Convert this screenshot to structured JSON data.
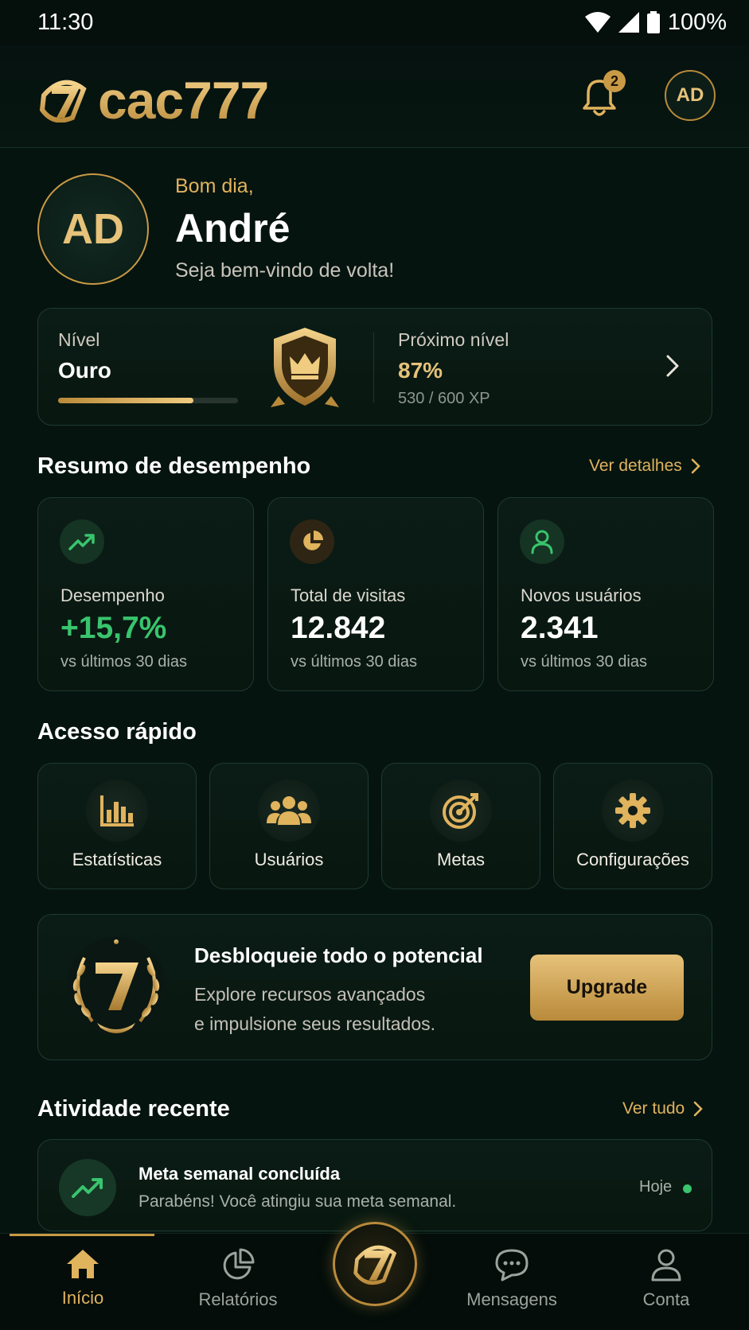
{
  "status_bar": {
    "time": "11:30",
    "battery": "100%"
  },
  "header": {
    "logo_text": "cac777",
    "notifications_count": "2",
    "avatar_initials": "AD"
  },
  "greeting": {
    "initials": "AD",
    "hello": "Bom dia,",
    "name": "André",
    "subtitle": "Seja bem-vindo de volta!"
  },
  "level": {
    "label": "Nível",
    "value": "Ouro",
    "progress": 0.75,
    "next_label": "Próximo nível",
    "next_value": "87%",
    "xp": "530 / 600 XP"
  },
  "performance": {
    "title": "Resumo de desempenho",
    "link": "Ver detalhes",
    "cards": [
      {
        "label": "Desempenho",
        "value": "+15,7%",
        "sub": "vs últimos 30 dias",
        "icon": "trending-up-icon"
      },
      {
        "label": "Total de visitas",
        "value": "12.842",
        "sub": "vs últimos 30 dias",
        "icon": "pie-chart-icon"
      },
      {
        "label": "Novos usuários",
        "value": "2.341",
        "sub": "vs últimos 30 dias",
        "icon": "user-icon"
      }
    ]
  },
  "quick_access": {
    "title": "Acesso rápido",
    "items": [
      {
        "label": "Estatísticas",
        "icon": "bar-chart-icon"
      },
      {
        "label": "Usuários",
        "icon": "users-icon"
      },
      {
        "label": "Metas",
        "icon": "target-icon"
      },
      {
        "label": "Configurações",
        "icon": "gear-icon"
      }
    ]
  },
  "promo": {
    "title": "Desbloqueie todo o potencial",
    "line1": "Explore recursos avançados",
    "line2": "e impulsione seus resultados.",
    "button": "Upgrade"
  },
  "activity": {
    "title": "Atividade recente",
    "link": "Ver tudo",
    "items": [
      {
        "title": "Meta semanal concluída",
        "sub": "Parabéns! Você atingiu sua meta semanal.",
        "time": "Hoje"
      }
    ]
  },
  "bottom_nav": {
    "items": [
      {
        "label": "Início",
        "icon": "home-icon",
        "active": true
      },
      {
        "label": "Relatórios",
        "icon": "reports-icon"
      },
      {
        "label": "Mensagens",
        "icon": "chat-icon"
      },
      {
        "label": "Conta",
        "icon": "account-icon"
      }
    ]
  },
  "colors": {
    "accent_gold": "#e0b35d",
    "positive_green": "#39c46d",
    "background": "#061410"
  }
}
